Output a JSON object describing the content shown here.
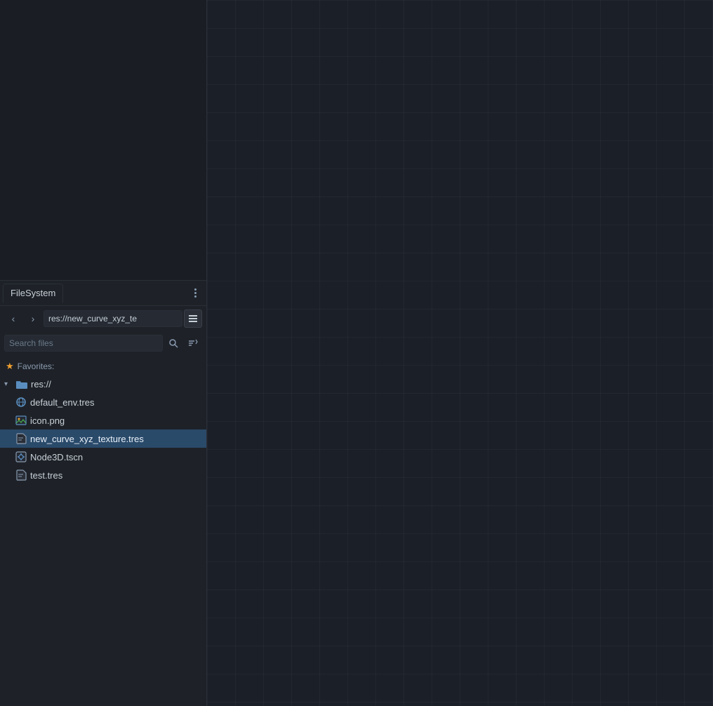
{
  "left_panel": {
    "tab": {
      "label": "FileSystem"
    },
    "toolbar": {
      "back_label": "‹",
      "forward_label": "›",
      "path_value": "res://new_curve_xyz_te",
      "display_toggle": "▤"
    },
    "search": {
      "placeholder": "Search files",
      "search_icon": "🔍",
      "sort_icon": "⇅"
    },
    "favorites": {
      "label": "Favorites:"
    },
    "tree": {
      "items": [
        {
          "id": "res",
          "label": "res://",
          "type": "folder",
          "expanded": true,
          "indent": "root",
          "icon": "folder"
        },
        {
          "id": "default_env",
          "label": "default_env.tres",
          "type": "resource",
          "indent": "child",
          "icon": "globe"
        },
        {
          "id": "icon",
          "label": "icon.png",
          "type": "image",
          "indent": "child",
          "icon": "image"
        },
        {
          "id": "new_curve",
          "label": "new_curve_xyz_texture.tres",
          "type": "resource",
          "indent": "child",
          "icon": "file",
          "selected": true
        },
        {
          "id": "node3d",
          "label": "Node3D.tscn",
          "type": "scene",
          "indent": "child",
          "icon": "scene"
        },
        {
          "id": "test",
          "label": "test.tres",
          "type": "resource",
          "indent": "child",
          "icon": "file"
        }
      ]
    }
  },
  "colors": {
    "selected_bg": "#2a4a6a",
    "folder_color": "#5b8ec0",
    "star_color": "#f0a030"
  }
}
